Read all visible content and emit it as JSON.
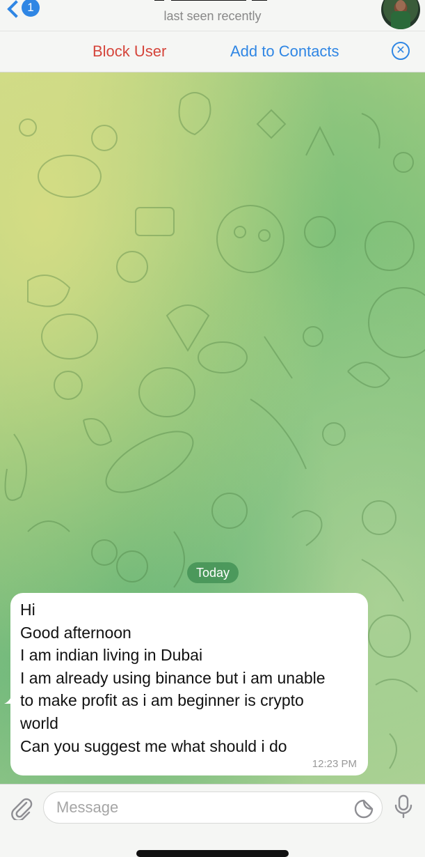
{
  "header": {
    "back_badge": "1",
    "status": "last seen recently"
  },
  "action_bar": {
    "block_label": "Block User",
    "add_label": "Add to Contacts",
    "close_glyph": "✕"
  },
  "chat": {
    "date_label": "Today",
    "message": {
      "lines": [
        "Hi",
        "Good afternoon",
        "I am indian living in Dubai",
        "I am already using binance but i am unable",
        "to make profit as i am beginner is crypto",
        "world",
        "Can you suggest me what should i do"
      ],
      "time": "12:23 PM"
    }
  },
  "composer": {
    "placeholder": "Message"
  },
  "icons": {
    "back": "chevron-left-icon",
    "attach": "paperclip-icon",
    "sticker": "sticker-icon",
    "mic": "microphone-icon",
    "close": "close-circle-icon"
  },
  "colors": {
    "accent": "#2f86e4",
    "danger": "#d5453b",
    "date_pill": "#3c8c50"
  }
}
